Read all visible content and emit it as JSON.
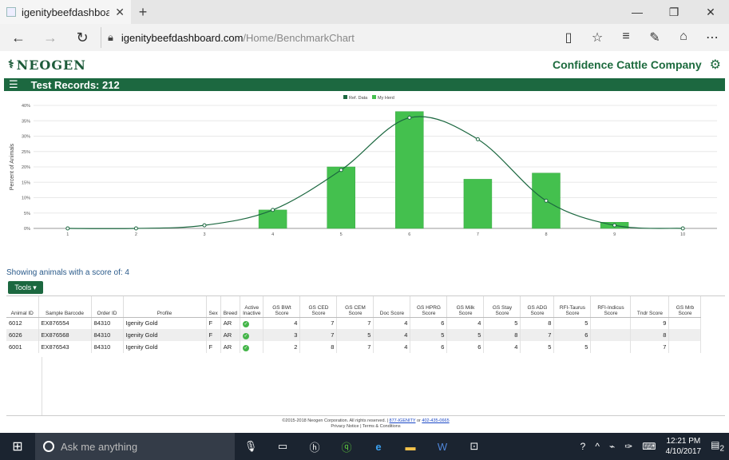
{
  "browser": {
    "tab_title": "igenitybeefdashboard.c",
    "url_host": "igenitybeefdashboard.com",
    "url_path": "/Home/BenchmarkChart"
  },
  "app": {
    "logo": "NEOGEN",
    "company": "Confidence Cattle Company",
    "test_records": "Test Records: 212",
    "showing": "Showing animals with a score of: 4",
    "tools_label": "Tools"
  },
  "chart_data": {
    "type": "bar",
    "legend": [
      "Ref. Data",
      "My Herd"
    ],
    "legend_position": "top",
    "colors": {
      "ref": "#1c6840",
      "herd": "#44c04e"
    },
    "ylabel": "Percent of Animals",
    "ylim": [
      0,
      40
    ],
    "yticks": [
      "0%",
      "5%",
      "10%",
      "15%",
      "20%",
      "25%",
      "30%",
      "35%",
      "40%"
    ],
    "categories": [
      "1",
      "2",
      "3",
      "4",
      "5",
      "6",
      "7",
      "8",
      "9",
      "10"
    ],
    "series": [
      {
        "name": "My Herd",
        "values": [
          0,
          0,
          0,
          6,
          20,
          38,
          16,
          18,
          2,
          0
        ]
      },
      {
        "name": "Ref. Data",
        "values": [
          0,
          0,
          1,
          6,
          19,
          36,
          29,
          9,
          1,
          0
        ]
      }
    ]
  },
  "table": {
    "columns": [
      "Animal ID",
      "Sample Barcode",
      "Order ID",
      "Profile",
      "Sex",
      "Breed",
      "Active Inactive",
      "GS BWt Score",
      "GS CED Score",
      "GS CEM Score",
      "Doc Score",
      "GS HPRG Score",
      "GS Milk Score",
      "GS Stay Score",
      "GS ADG Score",
      "RFI-Taurus Score",
      "RFI-Indicus Score",
      "Tndr Score",
      "GS Mrb Score"
    ],
    "rows": [
      [
        "6012",
        "EX876554",
        "84310",
        "Igenity Gold",
        "F",
        "AR",
        "✓",
        "4",
        "7",
        "7",
        "4",
        "6",
        "4",
        "5",
        "8",
        "5",
        "",
        "9",
        ""
      ],
      [
        "6026",
        "EX876568",
        "84310",
        "Igenity Gold",
        "F",
        "AR",
        "✓",
        "3",
        "7",
        "5",
        "4",
        "5",
        "5",
        "8",
        "7",
        "6",
        "",
        "8",
        ""
      ],
      [
        "6001",
        "EX876543",
        "84310",
        "Igenity Gold",
        "F",
        "AR",
        "✓",
        "2",
        "8",
        "7",
        "4",
        "6",
        "6",
        "4",
        "5",
        "5",
        "",
        "7",
        ""
      ]
    ]
  },
  "footer": {
    "line1_pre": "©2015-2018 Neogen Corporation. All rights reserved. | ",
    "phone1": "877-IGENITY",
    "or": " or ",
    "phone2": "402-435-0665",
    "line2": "Privacy Notice | Terms & Conditions"
  },
  "taskbar": {
    "search_placeholder": "Ask me anything",
    "time": "12:21 PM",
    "date": "4/10/2017",
    "notification_count": "2"
  }
}
